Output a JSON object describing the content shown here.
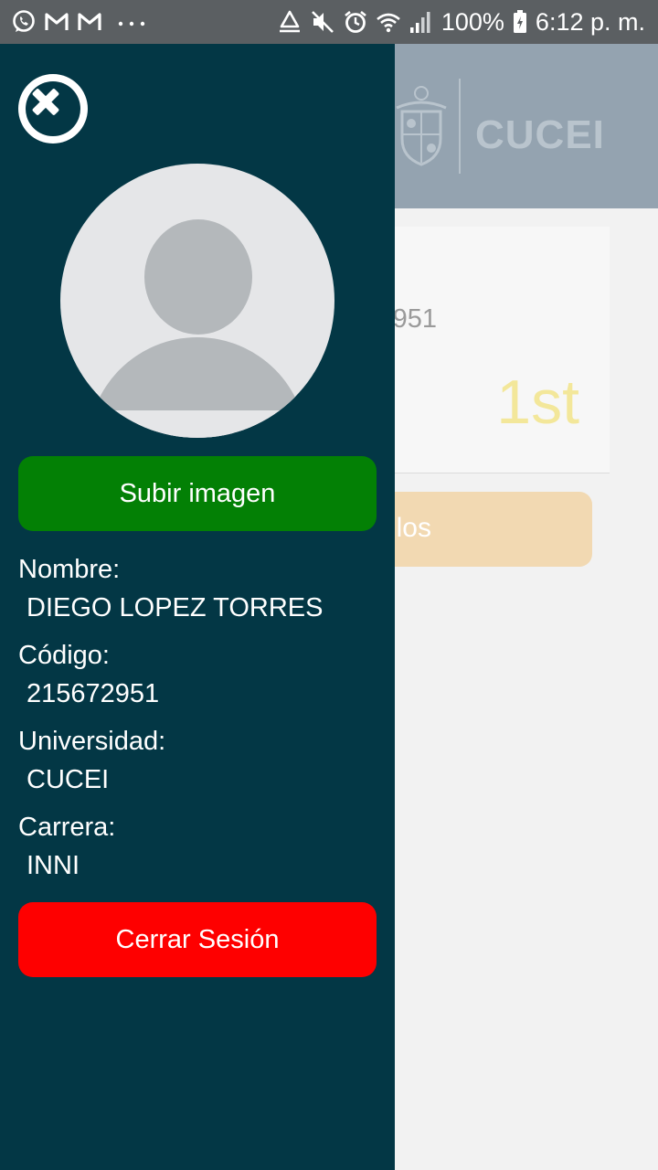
{
  "status_bar": {
    "left_icons": [
      "whatsapp-icon",
      "gmail-icon",
      "gmail-icon",
      "more-notifications-icon"
    ],
    "right_icons": [
      "recycle-icon",
      "mute-icon",
      "alarm-icon",
      "wifi-icon",
      "signal-icon"
    ],
    "battery": "100%",
    "time": "6:12 p. m."
  },
  "background_app": {
    "logo_text": "CUCEI",
    "code_partial": "951",
    "rank": "1st",
    "button_partial": "los"
  },
  "drawer": {
    "close_icon": "close-circle-icon",
    "upload_button": "Subir imagen",
    "fields": [
      {
        "label": "Nombre:",
        "value": "DIEGO LOPEZ TORRES"
      },
      {
        "label": "Código:",
        "value": "215672951"
      },
      {
        "label": "Universidad:",
        "value": "CUCEI"
      },
      {
        "label": "Carrera:",
        "value": "INNI"
      }
    ],
    "logout_button": "Cerrar Sesión"
  },
  "colors": {
    "drawer_bg": "#033745",
    "upload_green": "#038005",
    "logout_red": "#fe0000",
    "header_bg": "#94a3b0"
  }
}
